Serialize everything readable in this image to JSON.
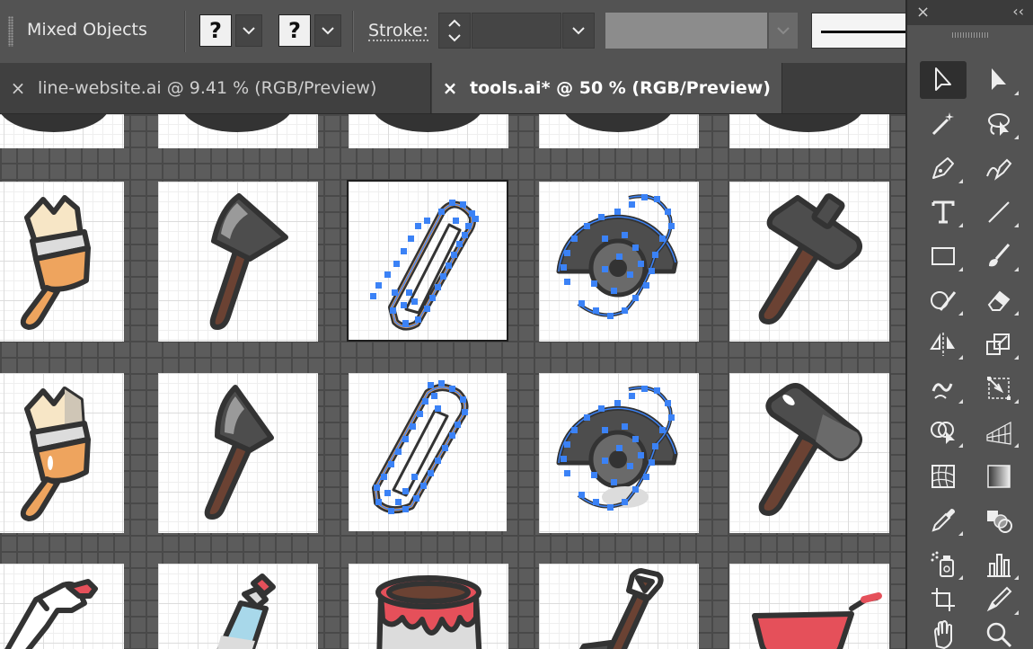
{
  "control_bar": {
    "selection_label": "Mixed Objects",
    "fill_placeholder": "?",
    "stroke_placeholder": "?",
    "stroke_label": "Stroke:",
    "stroke_weight_value": ""
  },
  "tabs": [
    {
      "label": "line-website.ai @ 9.41 % (RGB/Preview)",
      "active": false
    },
    {
      "label": "tools.ai* @ 50 % (RGB/Preview)",
      "active": true
    }
  ],
  "tools_panel": {
    "close_glyph": "×",
    "collapse_glyph": "‹‹",
    "tools": [
      {
        "name": "selection-tool",
        "active": true
      },
      {
        "name": "direct-selection-tool"
      },
      {
        "name": "magic-wand-tool"
      },
      {
        "name": "lasso-tool"
      },
      {
        "name": "pen-tool"
      },
      {
        "name": "curvature-tool"
      },
      {
        "name": "type-tool"
      },
      {
        "name": "line-segment-tool"
      },
      {
        "name": "rectangle-tool"
      },
      {
        "name": "paintbrush-tool"
      },
      {
        "name": "shaper-tool"
      },
      {
        "name": "eraser-tool"
      },
      {
        "name": "reflect-tool"
      },
      {
        "name": "scale-tool"
      },
      {
        "name": "warp-tool"
      },
      {
        "name": "free-transform-tool"
      },
      {
        "name": "shape-builder-tool"
      },
      {
        "name": "perspective-grid-tool"
      },
      {
        "name": "mesh-tool"
      },
      {
        "name": "gradient-tool"
      },
      {
        "name": "eyedropper-tool"
      },
      {
        "name": "blend-tool"
      },
      {
        "name": "symbol-sprayer-tool"
      },
      {
        "name": "column-graph-tool"
      },
      {
        "name": "artboard-tool"
      },
      {
        "name": "slice-tool"
      },
      {
        "name": "hand-tool"
      },
      {
        "name": "zoom-tool"
      }
    ]
  },
  "canvas": {
    "artboard_icons": [
      [
        "paintbrush-icon",
        "axe-icon",
        "hacksaw-icon",
        "saw-blade-icon",
        "hammer-icon"
      ],
      [
        "paintbrush-icon",
        "axe-icon",
        "hacksaw-icon",
        "saw-blade-icon",
        "hammer-icon"
      ],
      [
        "spray-bottle-icon",
        "spray-can-icon",
        "paint-bucket-icon",
        "shovel-icon",
        "wheelbarrow-icon"
      ]
    ],
    "selected_artboard": "row1-col3",
    "colors": {
      "outline": "#333333",
      "orange": "#eea45e",
      "cream": "#f7e6c6",
      "gray_light": "#dcdcdc",
      "gray_mid": "#9a9a9a",
      "dark_gray": "#4d4d4d",
      "brown": "#6b4233",
      "paint_red": "#e5505a",
      "light_blue": "#a8d8ea",
      "selection_blue": "#3b82f6"
    }
  }
}
